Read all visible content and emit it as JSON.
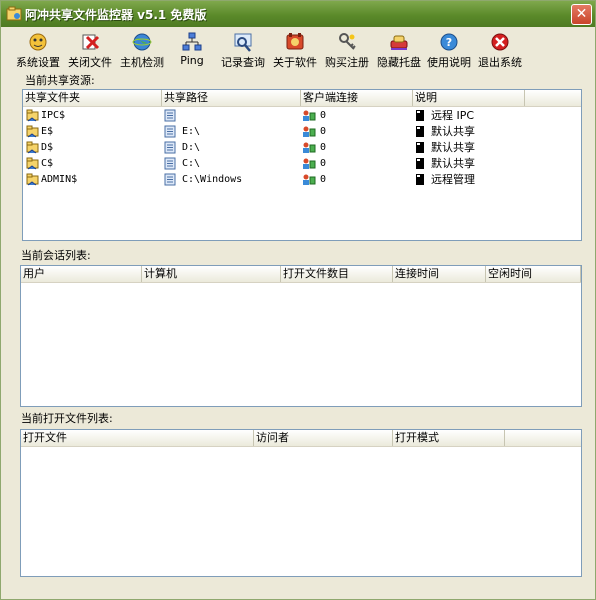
{
  "window": {
    "title": "阿冲共享文件监控器 v5.1 免费版"
  },
  "toolbar": {
    "items": [
      {
        "label": "系统设置",
        "icon": "settings-icon"
      },
      {
        "label": "关闭文件",
        "icon": "close-file-icon"
      },
      {
        "label": "主机检测",
        "icon": "globe-icon"
      },
      {
        "label": "Ping",
        "icon": "network-icon"
      },
      {
        "label": "记录查询",
        "icon": "magnifier-icon"
      },
      {
        "label": "关于软件",
        "icon": "about-icon"
      },
      {
        "label": "购买注册",
        "icon": "key-icon"
      },
      {
        "label": "隐藏托盘",
        "icon": "tray-icon"
      },
      {
        "label": "使用说明",
        "icon": "help-icon"
      },
      {
        "label": "退出系统",
        "icon": "exit-icon"
      }
    ]
  },
  "shares": {
    "label": "当前共享资源:",
    "columns": [
      "共享文件夹",
      "共享路径",
      "客户端连接",
      "说明"
    ],
    "rows": [
      {
        "name": "IPC$",
        "path": "",
        "clients": "0",
        "desc": "远程 IPC"
      },
      {
        "name": "E$",
        "path": "E:\\",
        "clients": "0",
        "desc": "默认共享"
      },
      {
        "name": "D$",
        "path": "D:\\",
        "clients": "0",
        "desc": "默认共享"
      },
      {
        "name": "C$",
        "path": "C:\\",
        "clients": "0",
        "desc": "默认共享"
      },
      {
        "name": "ADMIN$",
        "path": "C:\\Windows",
        "clients": "0",
        "desc": "远程管理"
      }
    ]
  },
  "sessions": {
    "label": "当前会话列表:",
    "columns": [
      "用户",
      "计算机",
      "打开文件数目",
      "连接时间",
      "空闲时间"
    ]
  },
  "openfiles": {
    "label": "当前打开文件列表:",
    "columns": [
      "打开文件",
      "访问者",
      "打开模式"
    ]
  },
  "colors": {
    "titlebar": "#5B8A2A",
    "face": "#ECE9D8",
    "border": "#7F9DB9"
  }
}
